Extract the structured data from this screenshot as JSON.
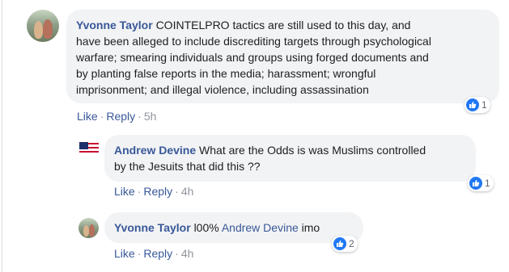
{
  "comments": [
    {
      "author": "Yvonne Taylor",
      "text_lines": [
        "COINTELPRO tactics are still used to this day, and",
        "have been alleged to include discrediting targets through psychological",
        "warfare; smearing individuals and groups using forged documents and",
        "by planting false reports in the media; harassment; wrongful",
        "imprisonment; and illegal violence, including assassination"
      ],
      "like_label": "Like",
      "reply_label": "Reply",
      "separator": "·",
      "time": "5h",
      "reaction_count": "1",
      "avatar_icon": "profile-photo-icon"
    },
    {
      "author": "Andrew Devine",
      "text_lines": [
        "What are the Odds is was Muslims controlled",
        "by the Jesuits that did this ??"
      ],
      "like_label": "Like",
      "reply_label": "Reply",
      "separator": "·",
      "time": "4h",
      "reaction_count": "1",
      "avatar_icon": "flag-avatar-icon"
    },
    {
      "author": "Yvonne Taylor",
      "text_prefix": "l00%",
      "mention": "Andrew Devine",
      "text_suffix": "imo",
      "like_label": "Like",
      "reply_label": "Reply",
      "separator": "·",
      "time": "4h",
      "reaction_count": "2",
      "avatar_icon": "profile-photo-icon"
    }
  ],
  "colors": {
    "link": "#385898",
    "bubble": "#f2f3f5",
    "like_blue": "#2078f4"
  }
}
